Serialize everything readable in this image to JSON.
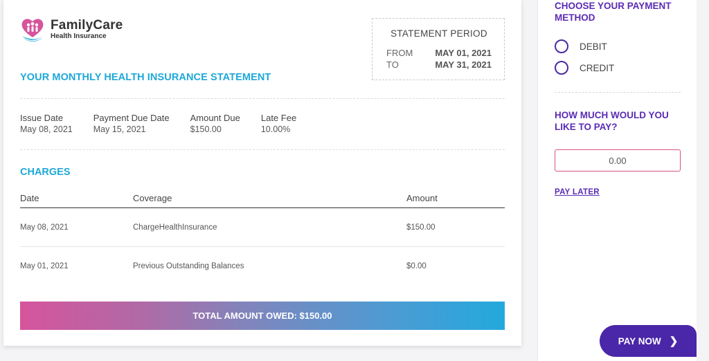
{
  "brand": {
    "name": "FamilyCare",
    "subtitle": "Health Insurance",
    "logo_icon": "heart-family-icon",
    "colors": {
      "accent_blue": "#1da8d8",
      "accent_purple": "#5a2bb4",
      "accent_pink": "#d6549c"
    }
  },
  "statement_period": {
    "title": "STATEMENT PERIOD",
    "from_label": "FROM",
    "from_value": "MAY 01, 2021",
    "to_label": "TO",
    "to_value": "MAY 31, 2021"
  },
  "page_title": "YOUR MONTHLY HEALTH INSURANCE STATEMENT",
  "summary": [
    {
      "label": "Issue Date",
      "value": "May 08, 2021"
    },
    {
      "label": "Payment Due Date",
      "value": "May 15, 2021"
    },
    {
      "label": "Amount Due",
      "value": "$150.00"
    },
    {
      "label": "Late Fee",
      "value": "10.00%"
    }
  ],
  "charges": {
    "title": "CHARGES",
    "columns": {
      "date": "Date",
      "coverage": "Coverage",
      "amount": "Amount"
    },
    "rows": [
      {
        "date": "May 08, 2021",
        "coverage": "ChargeHealthInsurance",
        "amount": "$150.00"
      },
      {
        "date": "May 01, 2021",
        "coverage": "Previous Outstanding Balances",
        "amount": "$0.00"
      }
    ]
  },
  "total": "TOTAL AMOUNT OWED: $150.00",
  "payment": {
    "method_title": "CHOOSE YOUR PAYMENT METHOD",
    "options": [
      "DEBIT",
      "CREDIT"
    ],
    "amount_title": "HOW MUCH WOULD YOU LIKE TO PAY?",
    "amount_value": "0.00",
    "pay_later": "PAY LATER",
    "pay_now": "PAY NOW",
    "pay_now_icon": "chevron-right-icon"
  }
}
